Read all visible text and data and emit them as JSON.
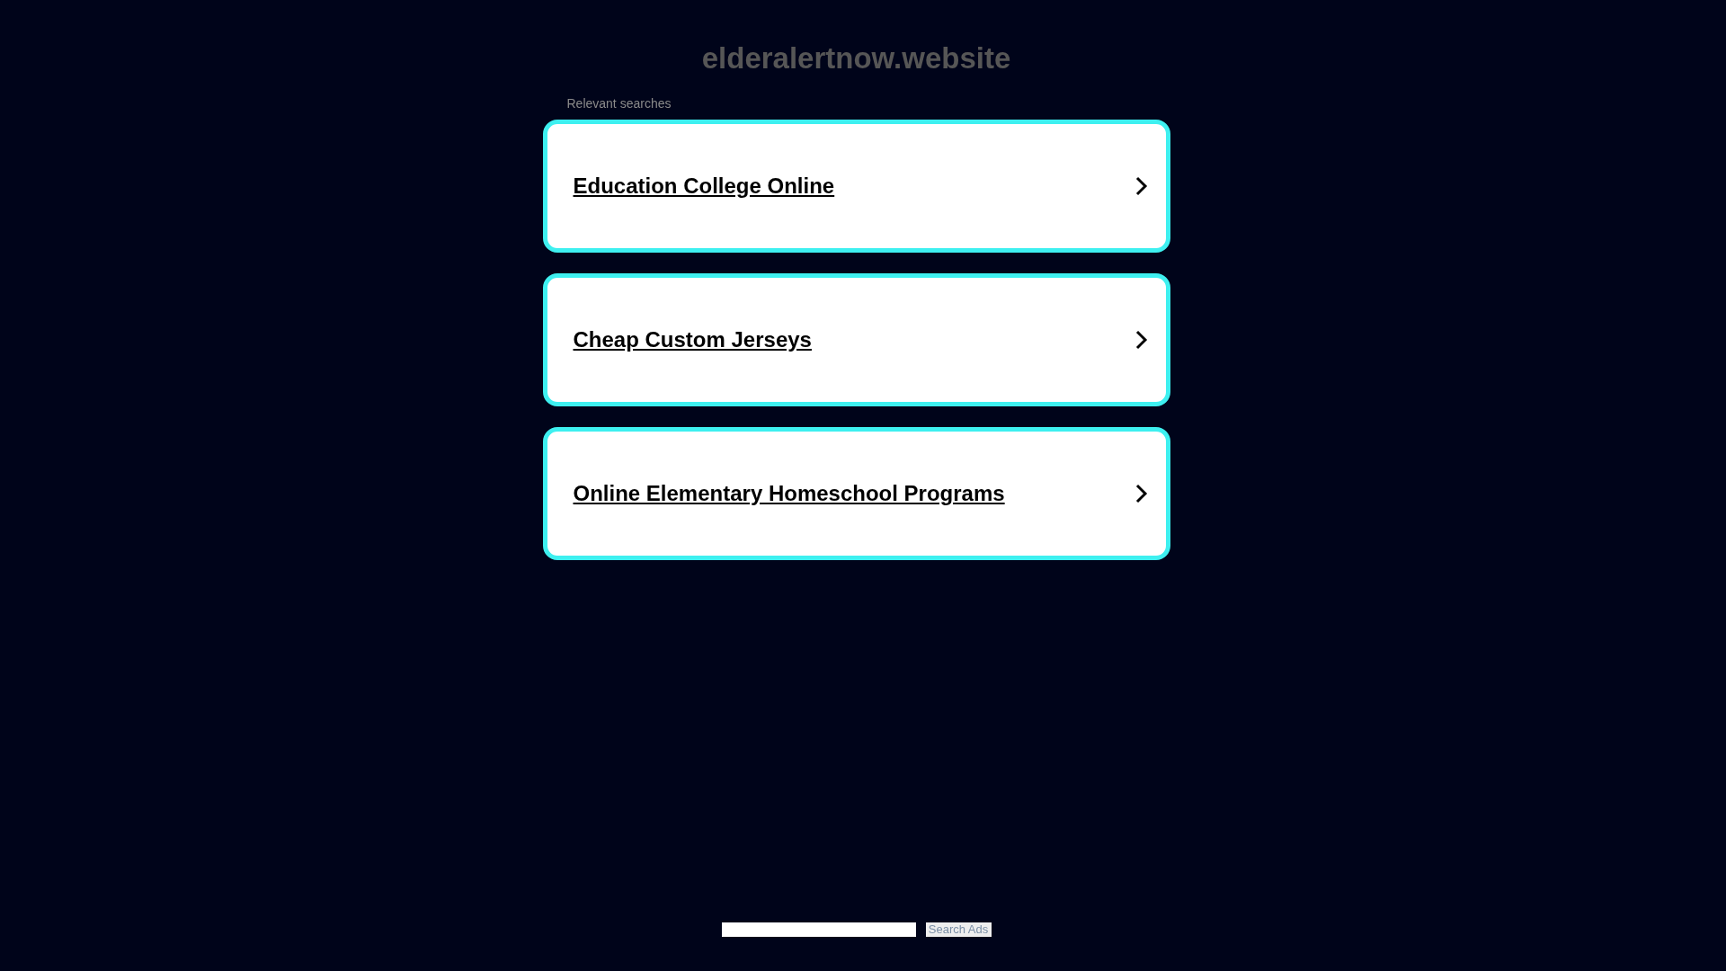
{
  "site_title": "elderalertnow.website",
  "section_label": "Relevant searches",
  "results": [
    {
      "label": "Education College Online"
    },
    {
      "label": "Cheap Custom Jerseys"
    },
    {
      "label": "Online Elementary Homeschool Programs"
    }
  ],
  "search": {
    "button": "Search Ads"
  }
}
